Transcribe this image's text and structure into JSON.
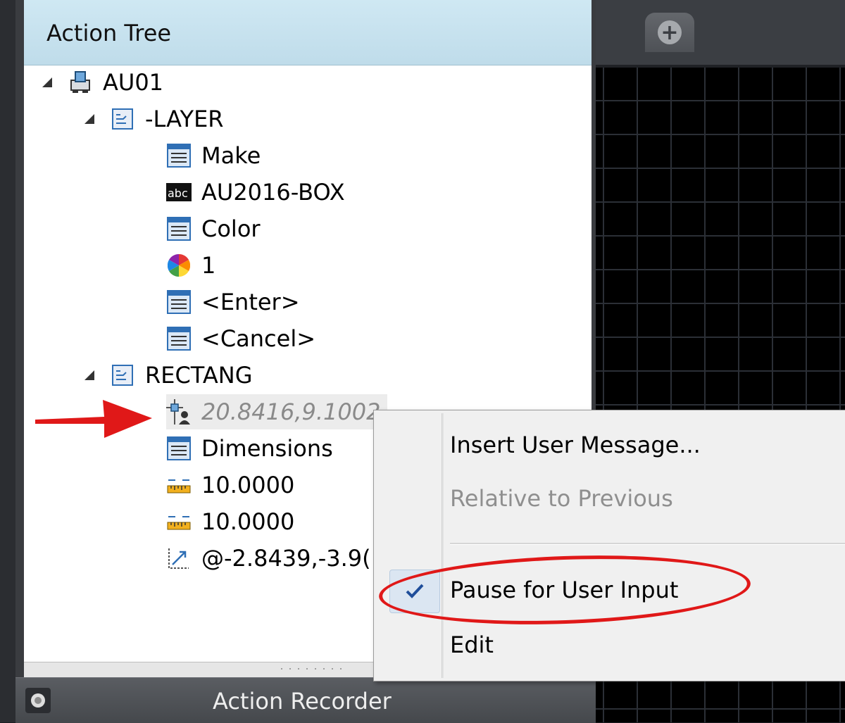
{
  "panel": {
    "title": "Action Tree"
  },
  "tree": {
    "root": "AU01",
    "layer": "-LAYER",
    "make": "Make",
    "au2016": "AU2016-BOX",
    "color": "Color",
    "color_value": "1",
    "enter": "<Enter>",
    "cancel": "<Cancel>",
    "rectang": "RECTANG",
    "point": "20.8416,9.1002",
    "dimensions": "Dimensions",
    "dim1": "10.0000",
    "dim2": "10.0000",
    "relative": "@-2.8439,-3.9("
  },
  "footer": {
    "title": "Action Recorder"
  },
  "menu": {
    "insert": "Insert User Message...",
    "relative": "Relative to Previous",
    "pause": "Pause for User Input",
    "edit": "Edit"
  },
  "colors": {
    "annotation": "#e01818",
    "header_bg": "#c8e3ef"
  }
}
